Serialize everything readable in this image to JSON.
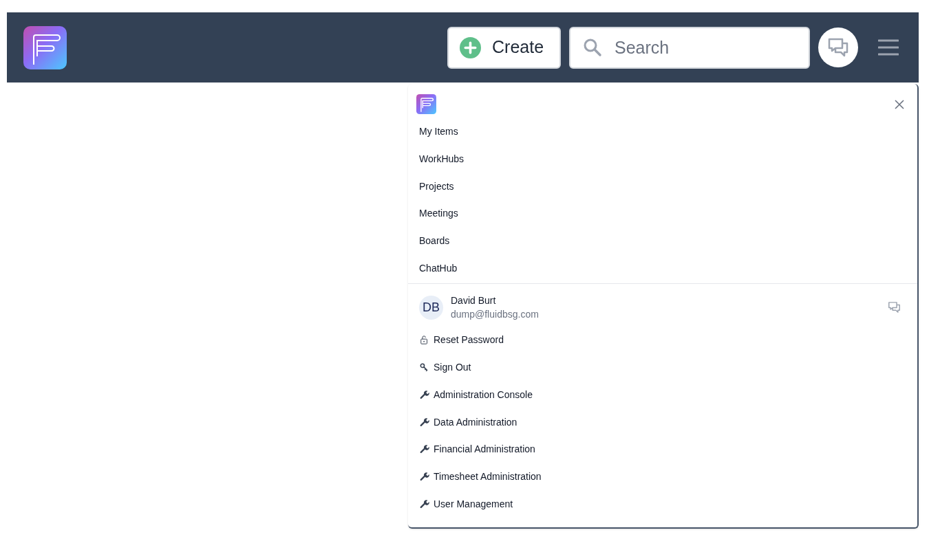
{
  "header": {
    "create_button": "Create",
    "search": {
      "placeholder": "Search"
    }
  },
  "menu": {
    "nav_items": [
      "My Items",
      "WorkHubs",
      "Projects",
      "Meetings",
      "Boards",
      "ChatHub"
    ],
    "user": {
      "initials": "DB",
      "name": "David Burt",
      "email": "dump@fluidbsg.com"
    },
    "actions": [
      {
        "kind": "lock",
        "label": "Reset Password"
      },
      {
        "kind": "key",
        "label": "Sign Out"
      },
      {
        "kind": "wrench",
        "label": "Administration Console"
      },
      {
        "kind": "wrench",
        "label": "Data Administration"
      },
      {
        "kind": "wrench",
        "label": "Financial Administration"
      },
      {
        "kind": "wrench",
        "label": "Timesheet Administration"
      },
      {
        "kind": "wrench",
        "label": "User Management"
      }
    ]
  }
}
